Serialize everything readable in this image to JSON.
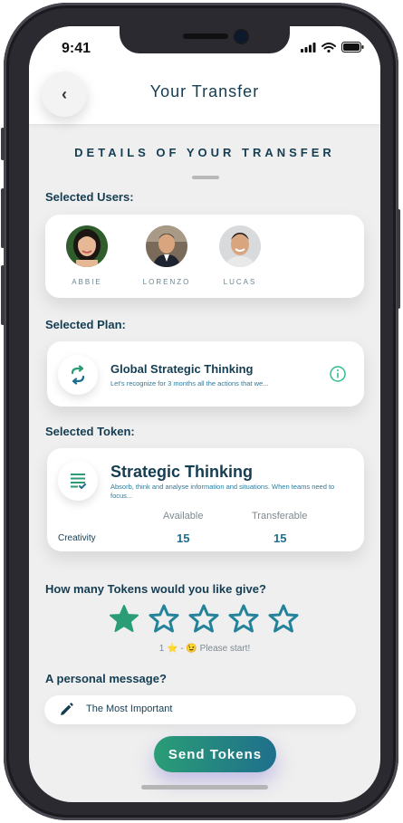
{
  "status_bar": {
    "time": "9:41"
  },
  "header": {
    "title": "Your Transfer",
    "back_icon": "chevron-left-icon",
    "back_glyph": "‹"
  },
  "section": {
    "title": "DETAILS OF YOUR TRANSFER"
  },
  "users_section": {
    "label": "Selected Users:",
    "users": [
      {
        "name": "ABBIE"
      },
      {
        "name": "LORENZO"
      },
      {
        "name": "LUCAS"
      }
    ]
  },
  "plan_section": {
    "label": "Selected Plan:",
    "title": "Global Strategic Thinking",
    "subtitle": "Let's recognize for 3 months all the actions that we...",
    "icon": "recycle-arrows-icon",
    "info_icon": "info-icon"
  },
  "token_section": {
    "label": "Selected Token:",
    "title": "Strategic Thinking",
    "description": "Absorb, think and analyse information and situations. When teams need to focus...",
    "icon": "checklist-icon",
    "category": "Creativity",
    "available_label": "Available",
    "available_value": "15",
    "transferable_label": "Transferable",
    "transferable_value": "15"
  },
  "rating": {
    "question": "How many Tokens would you like give?",
    "selected": 1,
    "max": 5,
    "hint": "1 ⭐ - 😉 Please start!"
  },
  "message": {
    "label": "A personal message?",
    "value": "The Most Important",
    "icon": "pencil-icon"
  },
  "send_button": {
    "label": "Send Tokens"
  },
  "colors": {
    "primary": "#143d52",
    "accent": "#2a9d76",
    "link": "#2b7a9c",
    "background": "#efefef"
  }
}
